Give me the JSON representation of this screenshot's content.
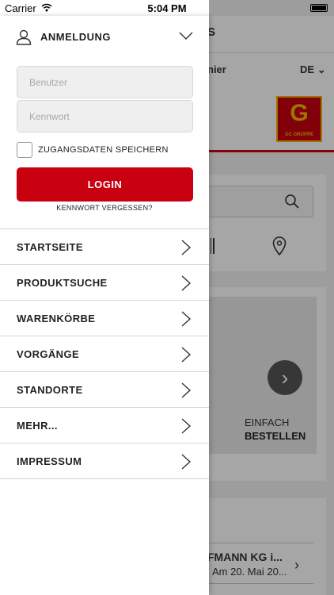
{
  "status_bar": {
    "carrier": "Carrier",
    "time": "5:04 PM"
  },
  "background": {
    "title_fragment": "S",
    "partner_fragment": "nier",
    "language": "DE",
    "logo_text": "GC GRUPPE",
    "promo_line1": "EINFACH",
    "promo_line2": "BESTELLEN",
    "order_title": "FMANN KG i...",
    "order_date": "Am 20. Mai 20..."
  },
  "drawer": {
    "login_title": "ANMELDUNG",
    "username_placeholder": "Benutzer",
    "password_placeholder": "Kennwort",
    "remember_label": "ZUGANGSDATEN SPEICHERN",
    "login_button": "LOGIN",
    "forgot_link": "KENNWORT VERGESSEN?",
    "menu": [
      {
        "label": "STARTSEITE"
      },
      {
        "label": "PRODUKTSUCHE"
      },
      {
        "label": "WARENKÖRBE"
      },
      {
        "label": "VORGÄNGE"
      },
      {
        "label": "STANDORTE"
      },
      {
        "label": "MEHR..."
      },
      {
        "label": "IMPRESSUM"
      }
    ]
  },
  "colors": {
    "brand_red": "#c8000f",
    "logo_gold": "#f5b200"
  }
}
